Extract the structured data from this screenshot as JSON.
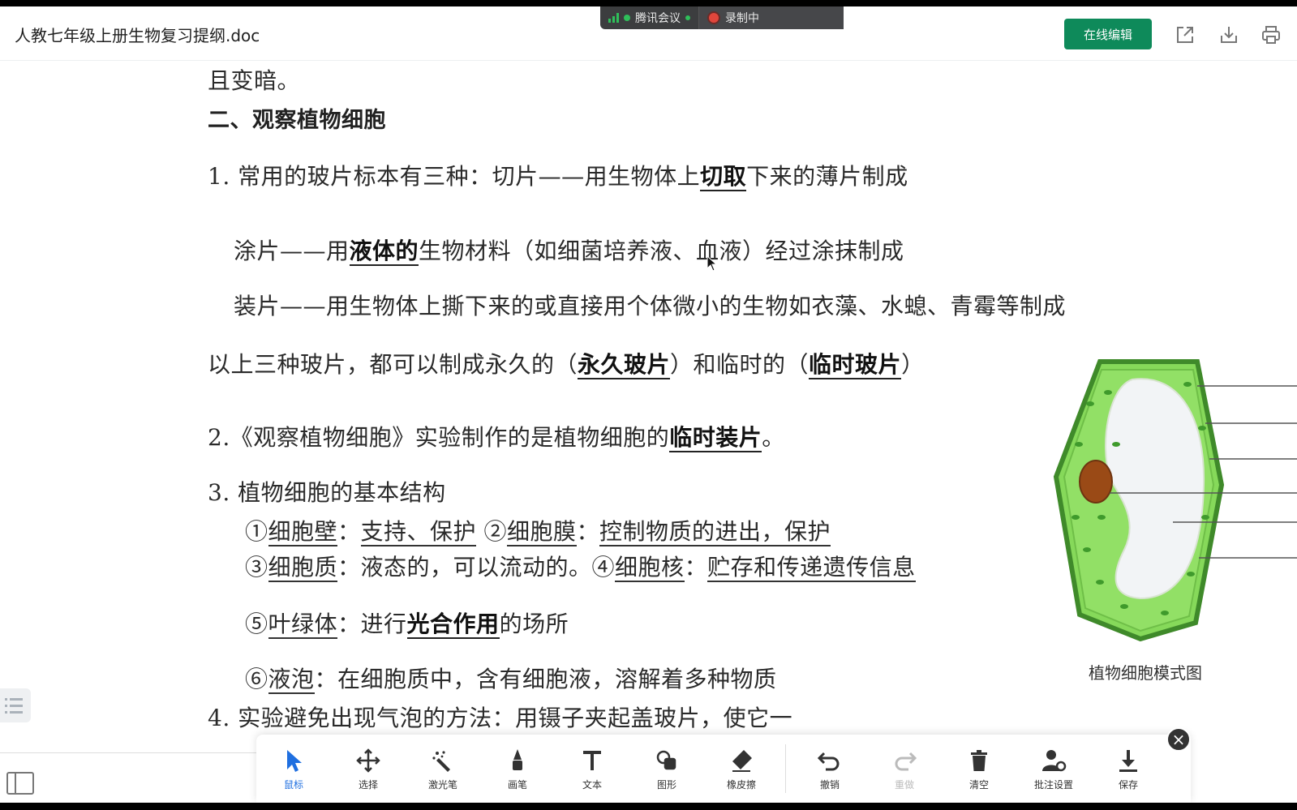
{
  "header": {
    "doc_title": "人教七年级上册生物复习提纲.doc",
    "meeting_label": "腾讯会议",
    "recording_label": "录制中",
    "edit_button": "在线编辑"
  },
  "doc": {
    "l0": "且变暗。",
    "heading": "二、观察植物细胞",
    "l1a": "1. 常用的玻片标本有三种：切片——用生物体上",
    "l1b": "切取",
    "l1c": "下来的薄片制成",
    "l2a": "涂片——用",
    "l2b": "液体的",
    "l2c": "生物材料（如细菌培养液、血液）经过涂抹制成",
    "l3": "装片——用生物体上撕下来的或直接用个体微小的生物如衣藻、水螅、青霉等制成",
    "l4a": "以上三种玻片，都可以制成永久的（",
    "l4b": "永久玻片",
    "l4c": "）和临时的（",
    "l4d": "临时玻片",
    "l4e": "）",
    "l5a": "2.《观察植物细胞》实验制作的是植物细胞的",
    "l5b": "临时装片",
    "l5c": "。",
    "l6": "3. 植物细胞的基本结构",
    "l7a": "①",
    "l7b": "细胞壁",
    "l7c": "：",
    "l7d": "支持、保护",
    "l7e": "②",
    "l7f": "细胞膜",
    "l7g": "：",
    "l7h": "控制物质的进出，保护",
    "l8a": "③",
    "l8b": "细胞质",
    "l8c": "：液态的，可以流动的。④",
    "l8d": "细胞核",
    "l8e": "：",
    "l8f": "贮存和传递遗传信息",
    "l9a": "⑤",
    "l9b": "叶绿体",
    "l9c": "：进行",
    "l9d": "光合作用",
    "l9e": "的场所",
    "l10a": "⑥",
    "l10b": "液泡",
    "l10c": "：在细胞质中，含有细胞液，溶解着多种物质",
    "l11": "4. 实验避免出现气泡的方法：用镊子夹起盖玻片，使它一",
    "caption": "植物细胞模式图"
  },
  "toolbar": [
    {
      "label": "鼠标",
      "icon": "cursor-icon",
      "state": "active"
    },
    {
      "label": "选择",
      "icon": "move-icon",
      "state": "normal"
    },
    {
      "label": "激光笔",
      "icon": "laser-pointer-icon",
      "state": "normal"
    },
    {
      "label": "画笔",
      "icon": "pen-icon",
      "state": "normal"
    },
    {
      "label": "文本",
      "icon": "text-icon",
      "state": "normal"
    },
    {
      "label": "图形",
      "icon": "shape-icon",
      "state": "normal"
    },
    {
      "label": "橡皮擦",
      "icon": "eraser-icon",
      "state": "normal"
    },
    {
      "label": "撤销",
      "icon": "undo-icon",
      "state": "normal"
    },
    {
      "label": "重做",
      "icon": "redo-icon",
      "state": "disabled"
    },
    {
      "label": "清空",
      "icon": "trash-icon",
      "state": "normal"
    },
    {
      "label": "批注设置",
      "icon": "annotation-settings-icon",
      "state": "normal"
    },
    {
      "label": "保存",
      "icon": "download-icon",
      "state": "normal"
    }
  ],
  "colors": {
    "accent": "#0e8a5a",
    "active_tool": "#1f6fe0",
    "cell_green": "#7ed957",
    "nucleus": "#9a4a16"
  }
}
